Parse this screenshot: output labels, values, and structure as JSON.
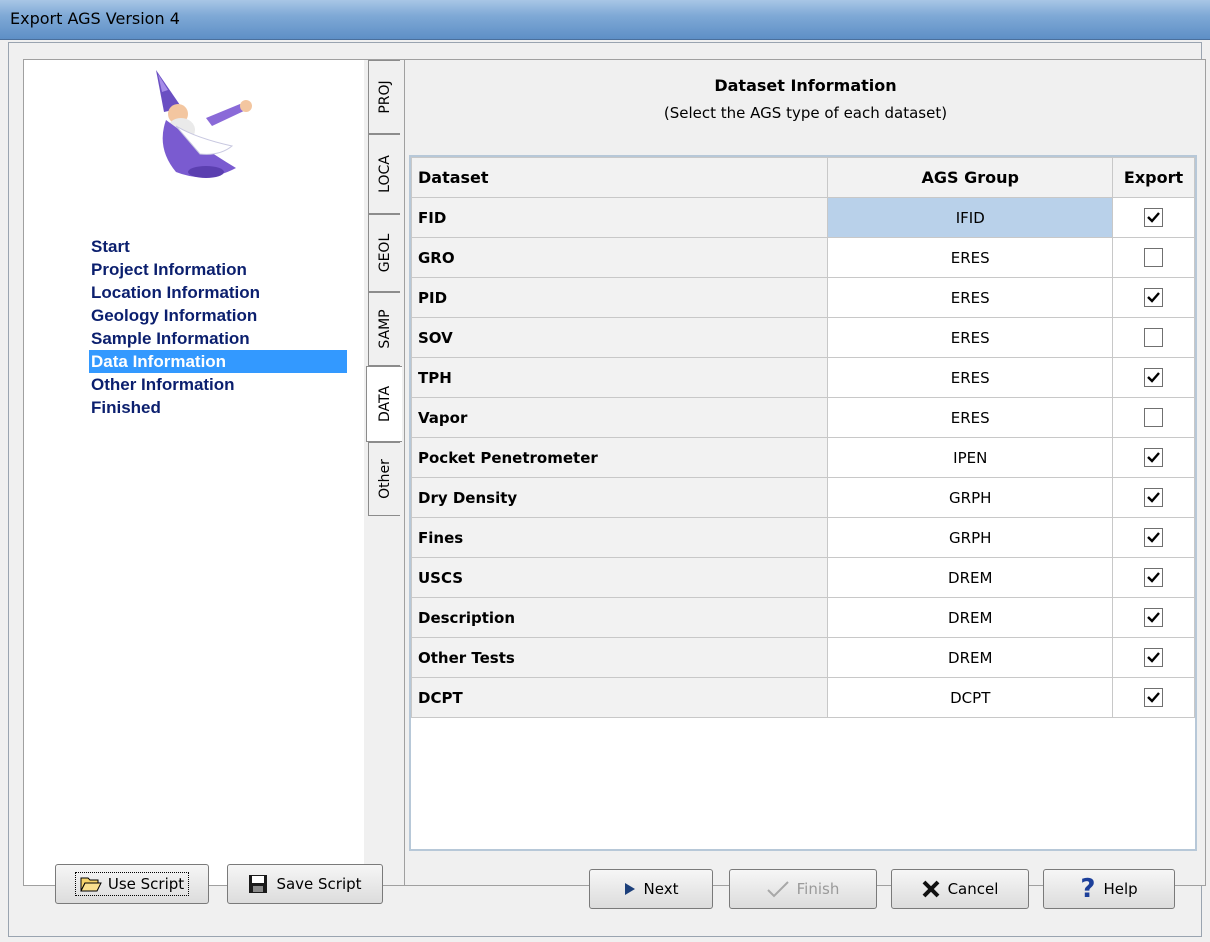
{
  "window": {
    "title": "Export AGS Version 4"
  },
  "steps": [
    "Start",
    "Project Information",
    "Location Information",
    "Geology Information",
    "Sample Information",
    "Data Information",
    "Other Information",
    "Finished"
  ],
  "active_step": "Data Information",
  "tabs": [
    "PROJ",
    "LOCA",
    "GEOL",
    "SAMP",
    "DATA",
    "Other"
  ],
  "active_tab": "DATA",
  "dataset": {
    "title": "Dataset Information",
    "subtitle": "(Select the AGS type of each dataset)",
    "columns": {
      "dataset": "Dataset",
      "group": "AGS Group",
      "export": "Export"
    },
    "rows": [
      {
        "name": "FID",
        "group": "IFID",
        "export": true
      },
      {
        "name": "GRO",
        "group": "ERES",
        "export": false
      },
      {
        "name": "PID",
        "group": "ERES",
        "export": true
      },
      {
        "name": "SOV",
        "group": "ERES",
        "export": false
      },
      {
        "name": "TPH",
        "group": "ERES",
        "export": true
      },
      {
        "name": "Vapor",
        "group": "ERES",
        "export": false
      },
      {
        "name": "Pocket Penetrometer",
        "group": "IPEN",
        "export": true
      },
      {
        "name": "Dry Density",
        "group": "GRPH",
        "export": true
      },
      {
        "name": "Fines",
        "group": "GRPH",
        "export": true
      },
      {
        "name": "USCS",
        "group": "DREM",
        "export": true
      },
      {
        "name": "Description",
        "group": "DREM",
        "export": true
      },
      {
        "name": "Other Tests",
        "group": "DREM",
        "export": true
      },
      {
        "name": "DCPT",
        "group": "DCPT",
        "export": true
      }
    ]
  },
  "buttons": {
    "use_script": "Use Script",
    "save_script": "Save Script",
    "next": "Next",
    "finish": "Finish",
    "cancel": "Cancel",
    "help": "Help"
  },
  "colors": {
    "selection": "#3399ff",
    "step_text": "#0b1f6e",
    "selected_cell": "#b9d1ea"
  }
}
